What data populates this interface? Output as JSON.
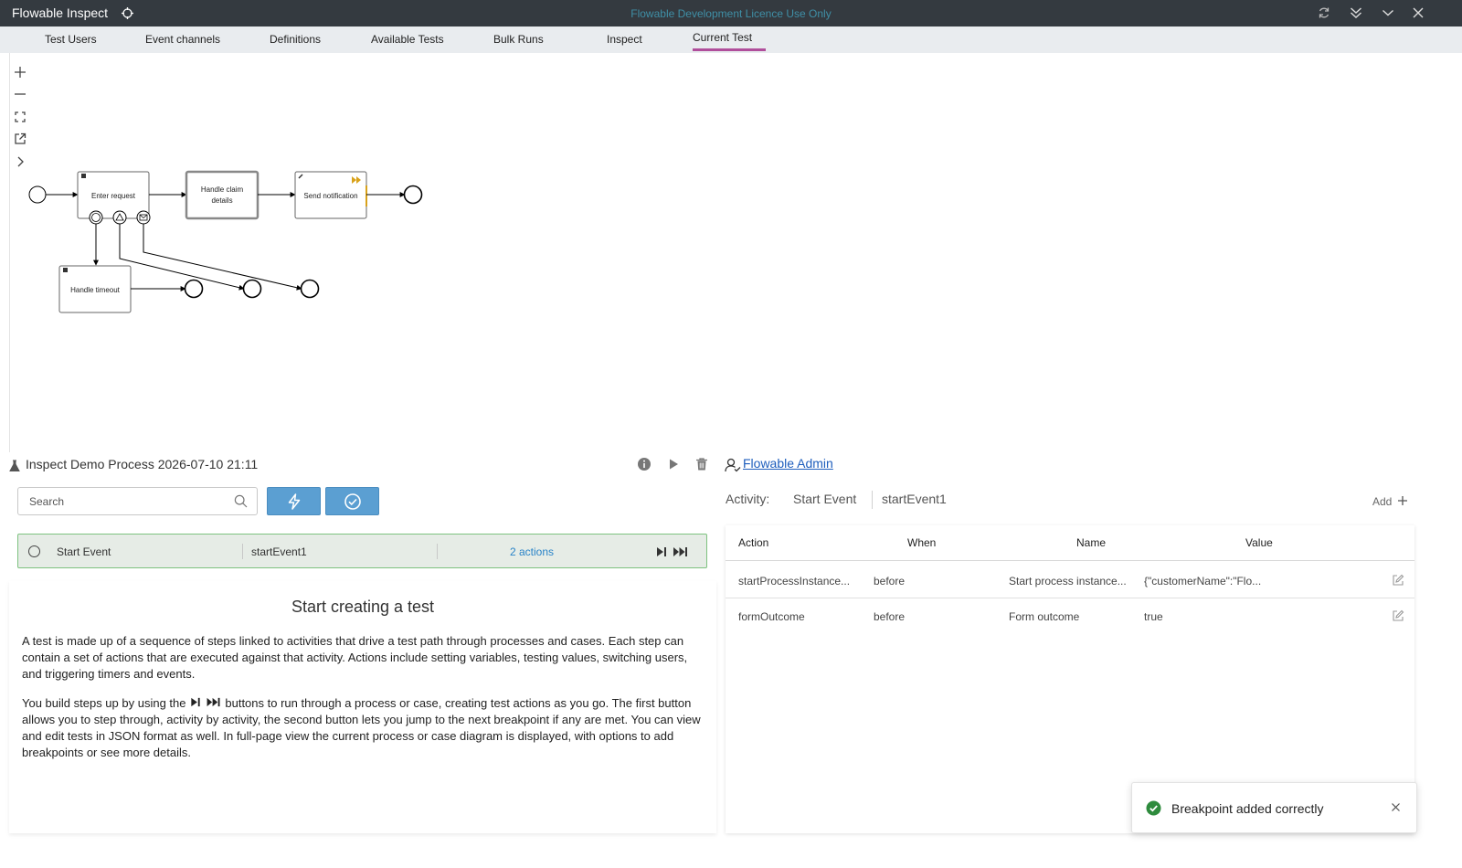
{
  "titlebar": {
    "app_title": "Flowable Inspect",
    "licence": "Flowable Development Licence Use Only"
  },
  "tabs": [
    {
      "label": "Test Users"
    },
    {
      "label": "Event channels"
    },
    {
      "label": "Definitions"
    },
    {
      "label": "Available Tests"
    },
    {
      "label": "Bulk Runs"
    },
    {
      "label": "Inspect"
    },
    {
      "label": "Current Test",
      "active": true
    }
  ],
  "diagram": {
    "tasks": {
      "enter_request": "Enter request",
      "handle_claim": [
        "Handle claim",
        "details"
      ],
      "send_notification": "Send notification",
      "handle_timeout": "Handle timeout"
    }
  },
  "test": {
    "title": "Inspect Demo Process 2026-07-10 21:11",
    "user": "Flowable Admin"
  },
  "search": {
    "placeholder": "Search"
  },
  "step": {
    "name": "Start Event",
    "id": "startEvent1",
    "actions": "2 actions"
  },
  "help": {
    "heading": "Start creating a test",
    "para1": "A test is made up of a sequence of steps linked to activities that drive a test path through processes and cases. Each step can contain a set of actions that are executed against that activity. Actions include setting variables, testing values, switching users, and triggering timers and events.",
    "para2_start": "You build steps up by using the",
    "para2_end": "buttons to run through a process or case, creating test actions as you go. The first button allows you to step through, activity by activity, the second button lets you jump to the next breakpoint if any are met. You can view and edit tests in JSON format as well. In full-page view the current process or case diagram is displayed, with options to add breakpoints or see more details."
  },
  "activity": {
    "label": "Activity:",
    "name": "Start Event",
    "id": "startEvent1",
    "add_label": "Add"
  },
  "table": {
    "headers": [
      "Action",
      "When",
      "Name",
      "Value"
    ],
    "rows": [
      {
        "action": "startProcessInstance...",
        "when": "before",
        "name": "Start process instance...",
        "value": "{\"customerName\":\"Flo..."
      },
      {
        "action": "formOutcome",
        "when": "before",
        "name": "Form outcome",
        "value": "true"
      }
    ]
  },
  "toast": {
    "message": "Breakpoint added correctly"
  },
  "colors": {
    "titlebar": "#343a40",
    "active_tab": "#b04e9b",
    "primary_button": "#5b9fd2",
    "step_border": "#7dc27f",
    "link": "#1e5ebd",
    "success": "#2e8b3d",
    "notification_marker": "#d9a21b"
  }
}
